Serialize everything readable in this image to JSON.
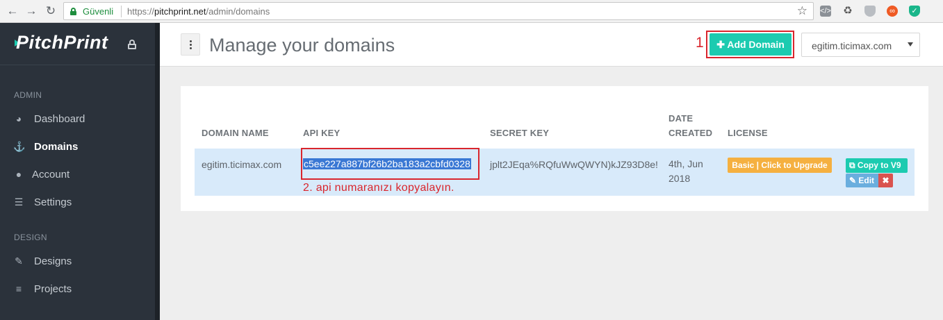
{
  "browser": {
    "secure_label": "Güvenli",
    "url_prefix": "https://",
    "url_host": "pitchprint.net",
    "url_path": "/admin/domains",
    "extensions": [
      "code-icon",
      "recycle-icon",
      "shield-icon",
      "infinity-icon",
      "vpn-shield-icon"
    ]
  },
  "sidebar": {
    "brand": "PitchPrint",
    "sections": [
      {
        "label": "ADMIN",
        "items": [
          {
            "label": "Dashboard",
            "icon": "dashboard-icon"
          },
          {
            "label": "Domains",
            "icon": "anchor-icon",
            "active": true
          },
          {
            "label": "Account",
            "icon": "user-icon"
          },
          {
            "label": "Settings",
            "icon": "sliders-icon"
          }
        ]
      },
      {
        "label": "DESIGN",
        "items": [
          {
            "label": "Designs",
            "icon": "edit-icon"
          },
          {
            "label": "Projects",
            "icon": "list-icon"
          }
        ]
      }
    ]
  },
  "header": {
    "title": "Manage your domains",
    "step_marker": "1",
    "add_button": "Add Domain",
    "domain_select": "egitim.ticimax.com"
  },
  "table": {
    "headers": {
      "domain": "DOMAIN NAME",
      "api_key": "API KEY",
      "secret_key": "SECRET KEY",
      "date_line1": "DATE",
      "date_line2": "CREATED",
      "license": "LICENSE"
    },
    "rows": [
      {
        "domain": "egitim.ticimax.com",
        "api_key": "c5ee227a887bf26b2ba183a2cbfd0328",
        "secret_key": "jplt2JEqa%RQfuWwQWYN)kJZ93D8e!",
        "date_line1": "4th, Jun",
        "date_line2": "2018",
        "license": "Basic | Click to Upgrade",
        "copy": "Copy to V9",
        "edit": "Edit"
      }
    ],
    "annotation": "2. api numaranızı kopyalayın."
  },
  "colors": {
    "accent": "#1ccbb0",
    "sidebar": "#2b323b",
    "annotation_red": "#d9252c",
    "license": "#f5b040",
    "selection": "#3a78d4"
  }
}
